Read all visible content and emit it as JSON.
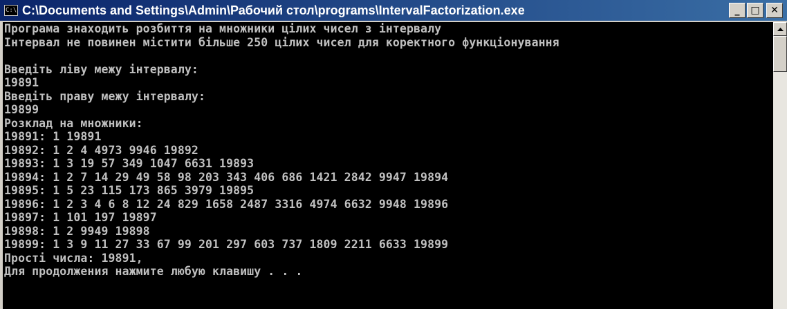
{
  "window": {
    "title": "C:\\Documents and Settings\\Admin\\Рабочий стол\\programs\\IntervalFactorization.exe",
    "icon_label": "C:\\",
    "minimize_glyph": "_",
    "maximize_glyph": "□",
    "close_glyph": "✕"
  },
  "console": {
    "lines": [
      "Програма знаходить розбиття на множники цілих чисел з інтервалу",
      "Інтервал не повинен містити більше 250 цілих чисел для коректного функціонування",
      "",
      "Введіть ліву межу інтервалу:",
      "19891",
      "Введіть праву межу інтервалу:",
      "19899",
      "Розклад на множники:",
      "19891: 1 19891",
      "19892: 1 2 4 4973 9946 19892",
      "19893: 1 3 19 57 349 1047 6631 19893",
      "19894: 1 2 7 14 29 49 58 98 203 343 406 686 1421 2842 9947 19894",
      "19895: 1 5 23 115 173 865 3979 19895",
      "19896: 1 2 3 4 6 8 12 24 829 1658 2487 3316 4974 6632 9948 19896",
      "19897: 1 101 197 19897",
      "19898: 1 2 9949 19898",
      "19899: 1 3 9 11 27 33 67 99 201 297 603 737 1809 2211 6633 19899",
      "Прості числа: 19891,",
      "Для продолжения нажмите любую клавишу . . ."
    ]
  },
  "colors": {
    "console_bg": "#000000",
    "console_fg": "#c0c0c0",
    "titlebar_start": "#0a246a",
    "titlebar_end": "#3a6ea5"
  }
}
